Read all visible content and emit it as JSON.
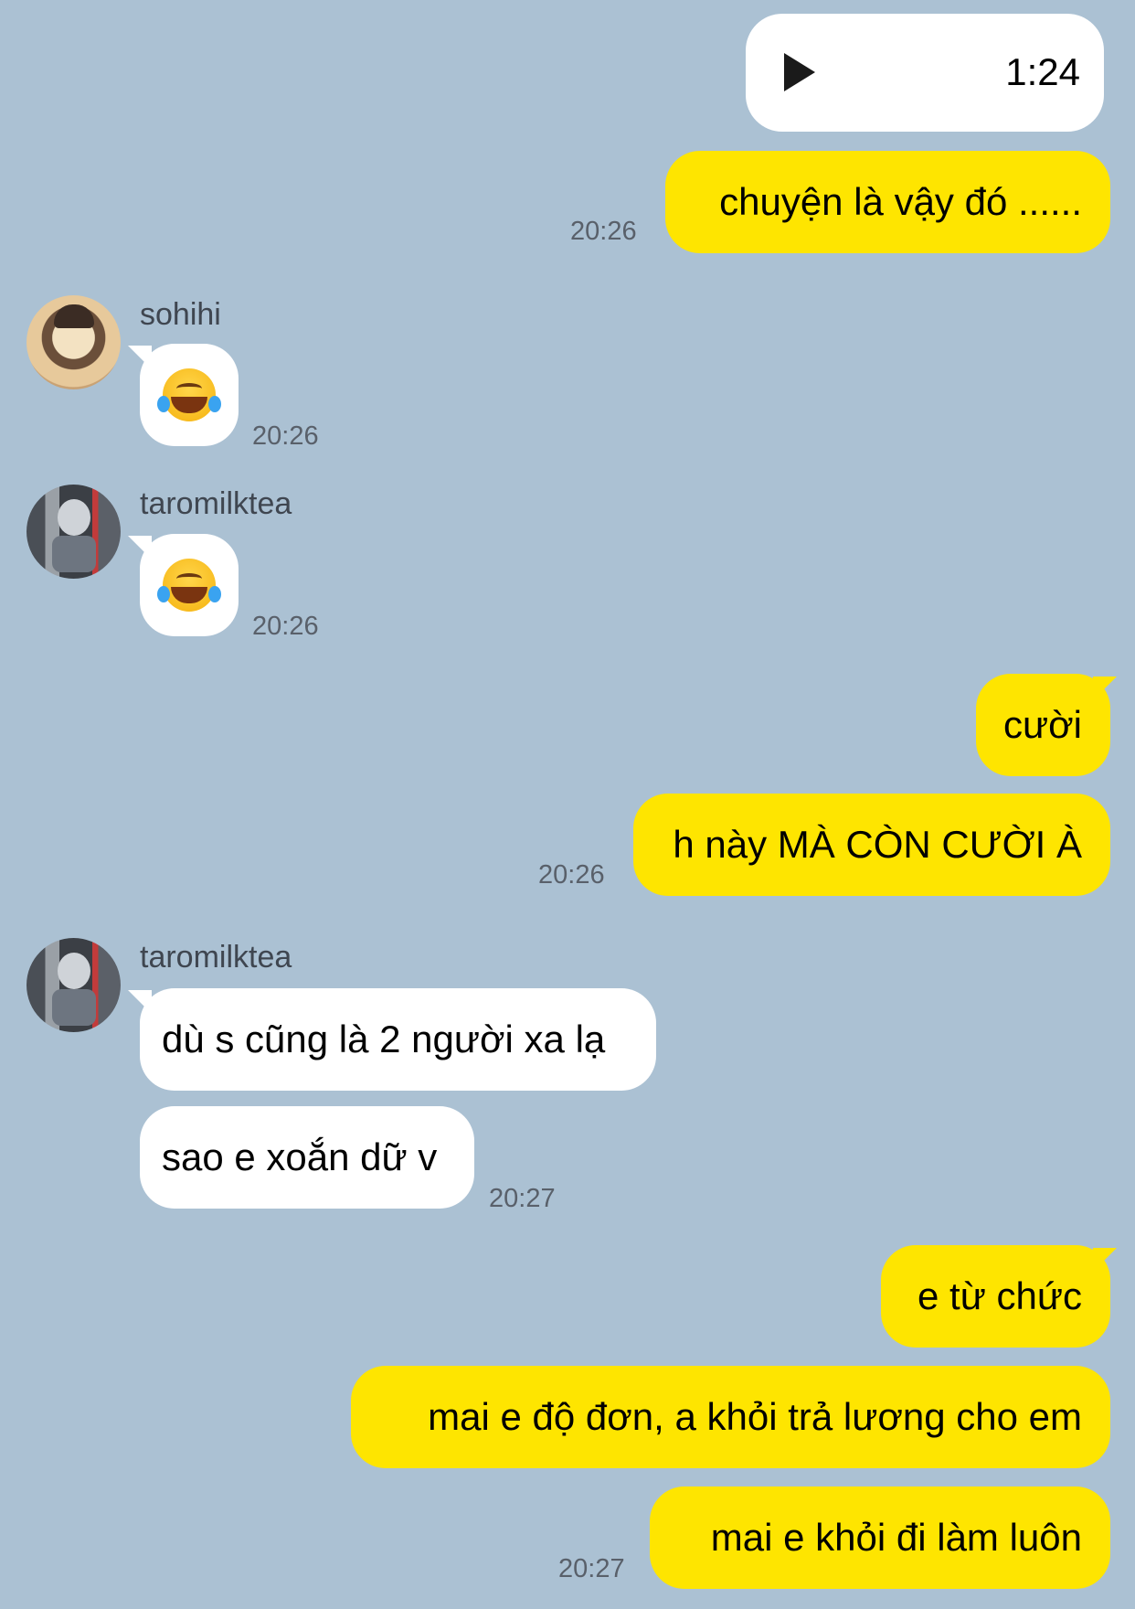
{
  "voice_message": {
    "duration": "1:24"
  },
  "messages": [
    {
      "sender": "me",
      "text": "chuyện là vậy đó ......",
      "time": "20:26"
    },
    {
      "sender": "sohihi",
      "emoji": "face-with-tears-of-joy",
      "time": "20:26"
    },
    {
      "sender": "taromilktea",
      "emoji": "face-with-tears-of-joy",
      "time": "20:26"
    },
    {
      "sender": "me",
      "text": "cười"
    },
    {
      "sender": "me",
      "text": "h này MÀ CÒN CƯỜI À",
      "time": "20:26"
    },
    {
      "sender": "taromilktea",
      "text": "dù s cũng là 2 người xa lạ"
    },
    {
      "sender": "taromilktea",
      "text": "sao e xoắn dữ v",
      "time": "20:27"
    },
    {
      "sender": "me",
      "text": "e từ chức"
    },
    {
      "sender": "me",
      "text": "mai e độ đơn, a khỏi trả lương cho em"
    },
    {
      "sender": "me",
      "text": "mai e khỏi đi làm luôn",
      "time": "20:27"
    }
  ],
  "contacts": {
    "sohihi": {
      "name": "sohihi"
    },
    "taromilktea": {
      "name": "taromilktea"
    }
  },
  "colors": {
    "background": "#abc1d3",
    "my_bubble": "#fee500",
    "their_bubble": "#ffffff"
  }
}
